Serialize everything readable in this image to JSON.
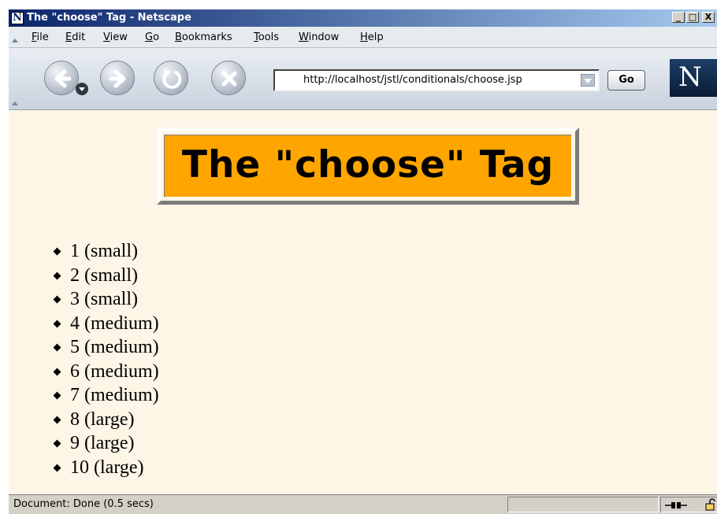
{
  "window": {
    "title": "The \"choose\" Tag - Netscape",
    "app_icon_letter": "N",
    "controls": {
      "minimize": "_",
      "maximize": "□",
      "close": "X"
    }
  },
  "menu": [
    {
      "letter": "F",
      "rest": "ile"
    },
    {
      "letter": "E",
      "rest": "dit"
    },
    {
      "letter": "V",
      "rest": "iew"
    },
    {
      "letter": "G",
      "rest": "o"
    },
    {
      "letter": "B",
      "rest": "ookmarks"
    },
    {
      "letter": "T",
      "rest": "ools"
    },
    {
      "letter": "W",
      "rest": "indow"
    },
    {
      "letter": "H",
      "rest": "elp"
    }
  ],
  "navigation": {
    "url": "http://localhost/jstl/conditionals/choose.jsp",
    "go_label": "Go",
    "buttons": [
      "back-icon",
      "forward-icon",
      "reload-icon",
      "stop-icon"
    ],
    "logo_letter": "N"
  },
  "page": {
    "heading": "The \"choose\" Tag",
    "items": [
      "1 (small)",
      "2 (small)",
      "3 (small)",
      "4 (medium)",
      "5 (medium)",
      "6 (medium)",
      "7 (medium)",
      "8 (large)",
      "9 (large)",
      "10 (large)"
    ]
  },
  "status": {
    "text": "Document: Done (0.5 secs)",
    "icons": [
      "connection-icon",
      "lock-icon"
    ]
  },
  "colors": {
    "titlebar": "#0a246a",
    "page_background": "#fdf5e6",
    "heading_background": "#ffa500"
  }
}
